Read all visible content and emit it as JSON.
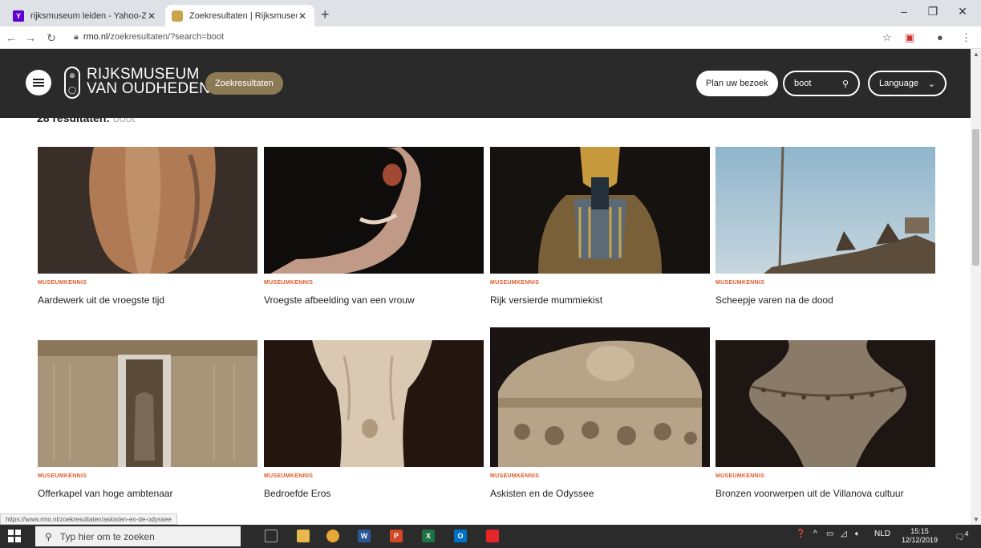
{
  "browser": {
    "tabs": [
      {
        "title": "rijksmuseum leiden - Yahoo-Zoe",
        "active": false
      },
      {
        "title": "Zoekresultaten | Rijksmuseum va",
        "active": true
      }
    ],
    "url_domain": "rmo.nl",
    "url_path": "/zoekresultaten/?search=boot",
    "status_url": "https://www.rmo.nl/zoekresultaten/askisten-en-de-odyssee"
  },
  "header": {
    "logo_line1": "RIJKSMUSEUM",
    "logo_line2": "VAN OUDHEDEN",
    "breadcrumb": "Zoekresultaten",
    "plan_label": "Plan uw bezoek",
    "search_value": "boot",
    "language_label": "Language"
  },
  "results": {
    "count_label": "28 resultaten:",
    "query": "boot",
    "cards": [
      {
        "category": "MUSEUMKENNIS",
        "title": "Aardewerk uit de vroegste tijd",
        "image": "aardewerk-vase"
      },
      {
        "category": "MUSEUMKENNIS",
        "title": "Vroegste afbeelding van een vrouw",
        "image": "clay-figurine"
      },
      {
        "category": "MUSEUMKENNIS",
        "title": "Rijk versierde mummiekist",
        "image": "mummy-coffin"
      },
      {
        "category": "MUSEUMKENNIS",
        "title": "Scheepje varen na de dood",
        "image": "model-boat"
      },
      {
        "category": "MUSEUMKENNIS",
        "title": "Offerkapel van hoge ambtenaar",
        "image": "offering-chapel"
      },
      {
        "category": "MUSEUMKENNIS",
        "title": "Bedroefde Eros",
        "image": "marble-eros"
      },
      {
        "category": "MUSEUMKENNIS",
        "title": "Askisten en de Odyssee",
        "image": "carved-urn"
      },
      {
        "category": "MUSEUMKENNIS",
        "title": "Bronzen voorwerpen uit de Villanova cultuur",
        "image": "bronze-vessel"
      }
    ]
  },
  "taskbar": {
    "search_placeholder": "Typ hier om te zoeken",
    "language": "NLD",
    "time": "15:15",
    "date": "12/12/2019",
    "notification_count": "4"
  },
  "colors": {
    "header_bg": "#2a2a2a",
    "breadcrumb_bg": "#8c7a55",
    "category": "#e0592a"
  }
}
